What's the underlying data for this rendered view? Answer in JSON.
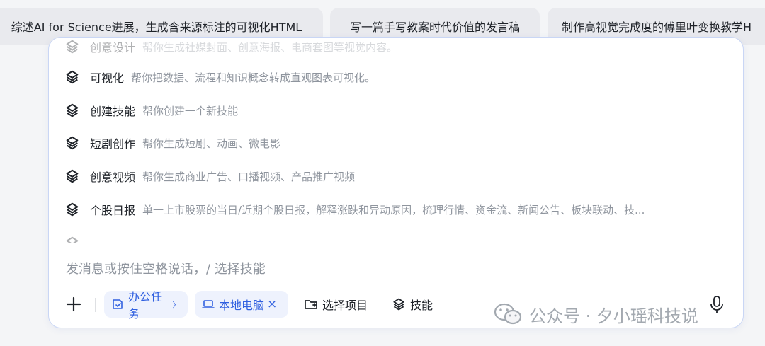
{
  "suggestions": [
    "综述AI for Science进展，生成含来源标注的可视化HTML",
    "写一篇手写教案时代价值的发言稿",
    "制作高视觉完成度的傅里叶变换教学H"
  ],
  "skills": [
    {
      "name": "创意设计",
      "desc": "帮你生成社媒封面、创意海报、电商套图等视觉内容。"
    },
    {
      "name": "可视化",
      "desc": "帮你把数据、流程和知识概念转成直观图表可视化。"
    },
    {
      "name": "创建技能",
      "desc": "帮你创建一个新技能"
    },
    {
      "name": "短剧创作",
      "desc": "帮你生成短剧、动画、微电影"
    },
    {
      "name": "创意视频",
      "desc": "帮你生成商业广告、口播视频、产品推广视频"
    },
    {
      "name": "个股日报",
      "desc": "单一上市股票的当日/近期个股日报，解释涨跌和异动原因，梳理行情、资金流、新闻公告、板块联动、技..."
    },
    {
      "name": "",
      "desc": ""
    }
  ],
  "composer": {
    "placeholder": "发消息或按住空格说话，/ 选择技能"
  },
  "toolbar": {
    "office_task": "办公任务",
    "office_chevron": "〉",
    "local_pc": "本地电脑",
    "remove": "×",
    "select_project": "选择项目",
    "skills": "技能"
  },
  "watermark": "公众号 · 夕小瑶科技说",
  "colors": {
    "accent": "#3060e0",
    "tag_bg": "#eef2fd",
    "border": "#c9d6f5"
  },
  "icons": {
    "skill": "skill-layers-icon",
    "plus": "plus-icon",
    "office": "office-task-icon",
    "laptop": "laptop-icon",
    "folder": "folder-add-icon",
    "mic": "microphone-icon"
  }
}
